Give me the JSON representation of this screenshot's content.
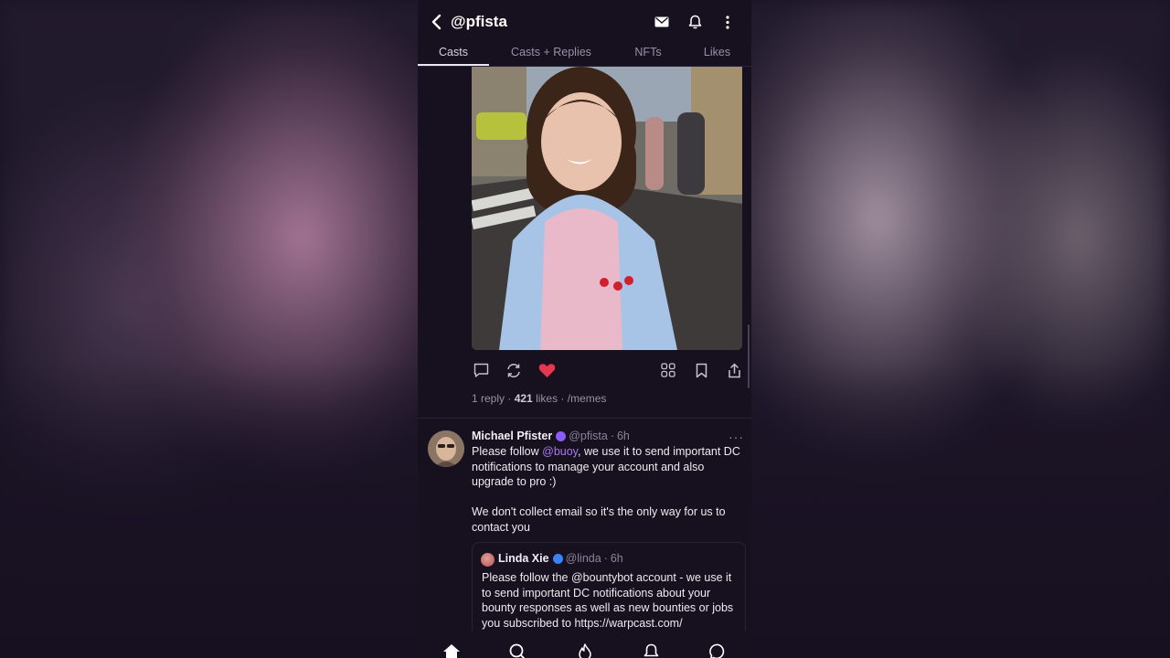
{
  "header": {
    "handle": "@pfista",
    "icons": [
      "back-icon",
      "mail-icon",
      "bell-icon",
      "more-vertical-icon"
    ]
  },
  "tabs": [
    {
      "label": "Casts",
      "active": true
    },
    {
      "label": "Casts + Replies",
      "active": false
    },
    {
      "label": "NFTs",
      "active": false
    },
    {
      "label": "Likes",
      "active": false
    }
  ],
  "first_post": {
    "image_icon": "photo-of-smiling-girl",
    "stats": {
      "replies": "1 reply",
      "likes_count": "421",
      "likes_word": " likes",
      "sep": " · ",
      "channel": "/memes"
    },
    "liked": true,
    "like_color": "#e5374f"
  },
  "second_post": {
    "author_name": "Michael Pfister",
    "author_handle": "@pfista",
    "time": "6h",
    "badge_color": "#8b5cf6",
    "text_before": "Please follow ",
    "mention": "@buoy",
    "text_after": ", we use it to send important DC notifications to manage your account and also upgrade to pro :)",
    "paragraph2": "We don't collect email so it's the only way for us to contact you",
    "more": "···",
    "quote": {
      "author_name": "Linda Xie",
      "author_handle": "@linda",
      "time": "6h",
      "badge_color": "#3b82f6",
      "text": "Please follow the @bountybot account - we use it to send important DC notifications about your bounty responses as well as new bounties or jobs you subscribed to https://warpcast.com/"
    }
  },
  "bottom_nav": [
    "home-icon",
    "search-icon",
    "fire-icon",
    "bell-icon",
    "chat-icon"
  ],
  "accent": "#a77bf0"
}
